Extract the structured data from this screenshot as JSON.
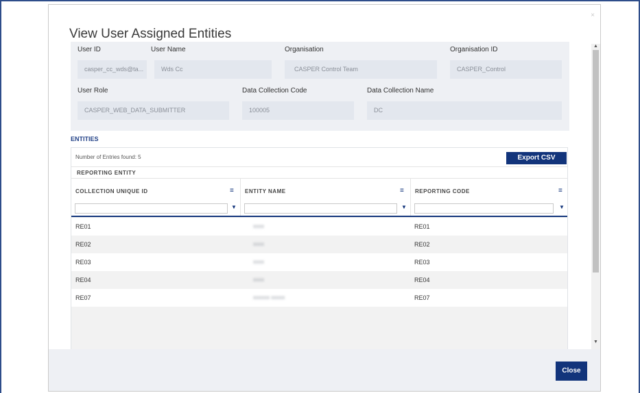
{
  "modal": {
    "close_x": "×",
    "title": "View User Assigned Entities"
  },
  "info": {
    "user_id_label": "User ID",
    "user_id_value": "casper_cc_wds@ta...",
    "user_name_label": "User Name",
    "user_name_value": "Wds Cc",
    "organisation_label": "Organisation",
    "organisation_value": "CASPER Control Team",
    "organisation_id_label": "Organisation ID",
    "organisation_id_value": "CASPER_Control",
    "user_role_label": "User Role",
    "user_role_value": "CASPER_WEB_DATA_SUBMITTER",
    "dc_code_label": "Data Collection Code",
    "dc_code_value": "100005",
    "dc_name_label": "Data Collection Name",
    "dc_name_value": "DC"
  },
  "entities": {
    "section_title": "ENTITIES",
    "entries_found": "Number of Entries found: 5",
    "export_label": "Export CSV",
    "group_header": "REPORTING ENTITY",
    "columns": [
      "COLLECTION UNIQUE ID",
      "ENTITY NAME",
      "REPORTING CODE"
    ],
    "menu_icon": "≡",
    "filter_icon": "▼",
    "rows": [
      {
        "id": "RE01",
        "name": "xxxx",
        "code": "RE01"
      },
      {
        "id": "RE02",
        "name": "xxxx",
        "code": "RE02"
      },
      {
        "id": "RE03",
        "name": "xxxx",
        "code": "RE03"
      },
      {
        "id": "RE04",
        "name": "xxxx",
        "code": "RE04"
      },
      {
        "id": "RE07",
        "name": "xxxxxx xxxxx",
        "code": "RE07"
      }
    ]
  },
  "footer": {
    "close_label": "Close"
  },
  "scrollbar": {
    "up": "▲",
    "down": "▼"
  },
  "colors": {
    "accent": "#12347b",
    "panel": "#eef0f4",
    "frame": "#2e4d8a"
  }
}
